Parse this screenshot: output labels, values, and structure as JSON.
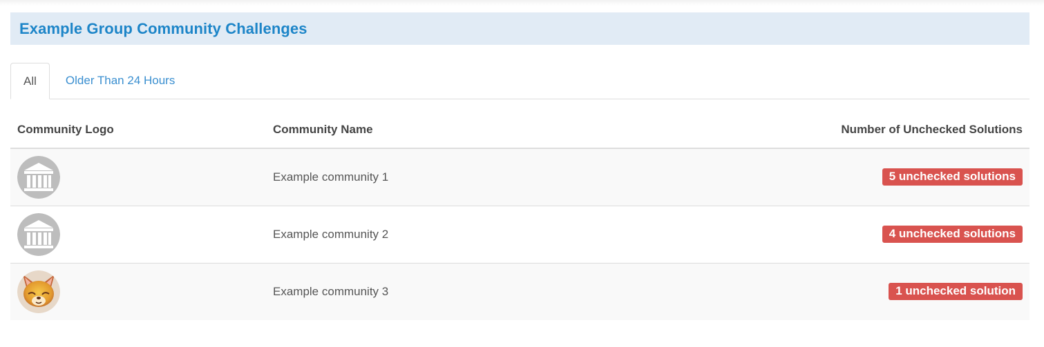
{
  "panel": {
    "title": "Example Group Community Challenges"
  },
  "tabs": [
    {
      "label": "All",
      "active": true
    },
    {
      "label": "Older Than 24 Hours",
      "active": false
    }
  ],
  "table": {
    "headers": {
      "logo": "Community Logo",
      "name": "Community Name",
      "unchecked": "Number of Unchecked Solutions"
    },
    "rows": [
      {
        "logo_icon": "institution-icon",
        "name": "Example community 1",
        "badge": "5 unchecked solutions"
      },
      {
        "logo_icon": "institution-icon",
        "name": "Example community 2",
        "badge": "4 unchecked solutions"
      },
      {
        "logo_icon": "fox-avatar-icon",
        "name": "Example community 3",
        "badge": "1 unchecked solution"
      }
    ]
  },
  "colors": {
    "accent": "#1d85c8",
    "heading_bg": "#e1ebf5",
    "badge_bg": "#d9534f",
    "link": "#3a8fd0"
  }
}
